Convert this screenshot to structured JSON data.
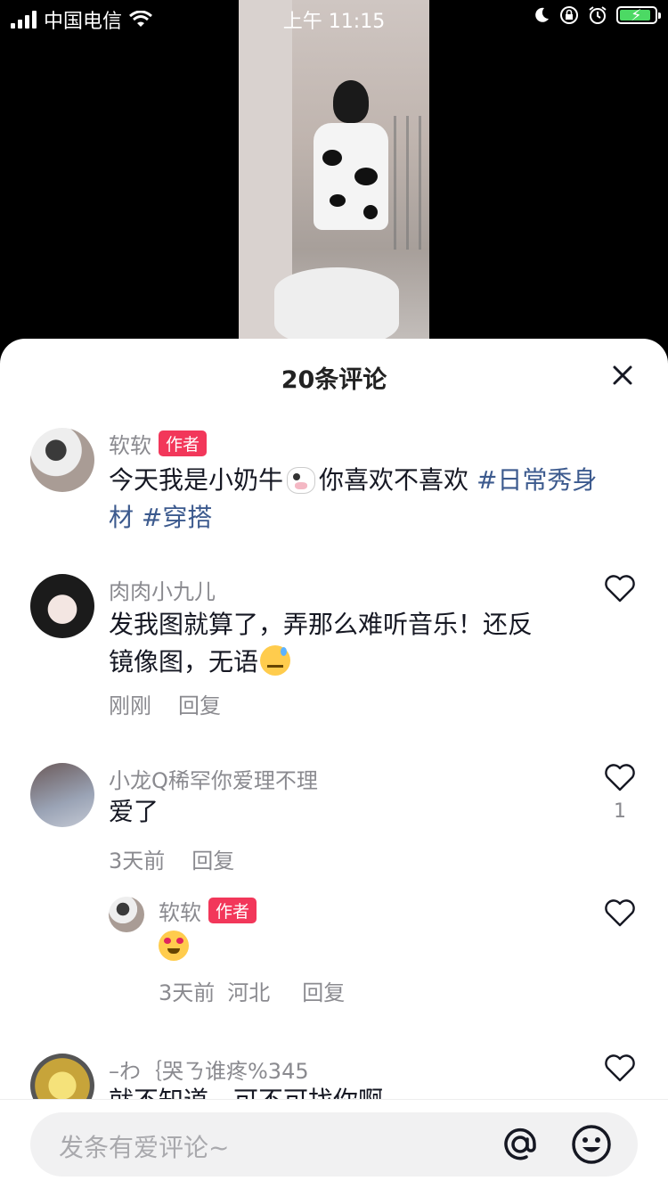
{
  "status": {
    "carrier": "中国电信",
    "time": "上午 11:15",
    "icons": [
      "signal-icon",
      "wifi-icon",
      "moon-icon",
      "orientation-lock-icon",
      "alarm-icon",
      "battery-charging-icon"
    ]
  },
  "video": {
    "description_icon": "video-frame"
  },
  "sheet": {
    "title": "20条评论",
    "close_icon": "close-icon"
  },
  "comments": [
    {
      "name": "软软",
      "badge": "作者",
      "text": "今天我是小奶牛",
      "text2": "你喜欢不喜欢",
      "tag1": "#日常秀身",
      "tag1b": "材",
      "tag2": "#穿搭"
    },
    {
      "name": "肉肉小九儿",
      "line1": "发我图就算了，弄那么难听音乐！还反",
      "line2": "镜像图，无语",
      "time": "刚刚",
      "reply": "回复"
    },
    {
      "name": "小龙Q稀罕你爱理不理",
      "text": "爱了",
      "time": "3天前",
      "reply": "回复",
      "likes": "1"
    },
    {
      "name": "软软",
      "badge": "作者",
      "time": "3天前",
      "location": "河北",
      "reply": "回复"
    },
    {
      "name": "–わ｛哭ㄋ谁疼%345",
      "text": "就不知道，可不可找你啊"
    }
  ],
  "input": {
    "placeholder": "发条有爱评论~",
    "at_icon": "at-icon",
    "emoji_icon": "emoji-icon"
  },
  "colors": {
    "accent": "#f2375a",
    "tag": "#3c5a8e",
    "muted": "#8a8a8f"
  }
}
